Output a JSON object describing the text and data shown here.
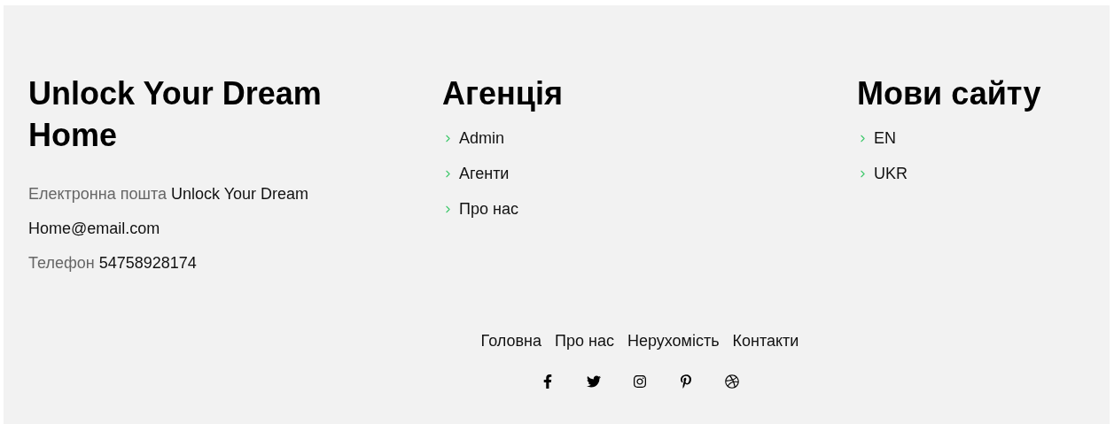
{
  "brand": {
    "title": "Unlock Your Dream Home",
    "contacts": [
      {
        "label": "Електронна пошта",
        "value": "Unlock Your Dream Home@email.com"
      },
      {
        "label": "Телефон",
        "value": "54758928174"
      }
    ]
  },
  "columns": [
    {
      "title": "Агенція",
      "links": [
        "Admin",
        "Агенти",
        "Про нас"
      ]
    },
    {
      "title": "Мови сайту",
      "links": [
        "EN",
        "UKR"
      ]
    }
  ],
  "bottom_nav": [
    "Головна",
    "Про нас",
    "Нерухомість",
    "Контакти"
  ]
}
